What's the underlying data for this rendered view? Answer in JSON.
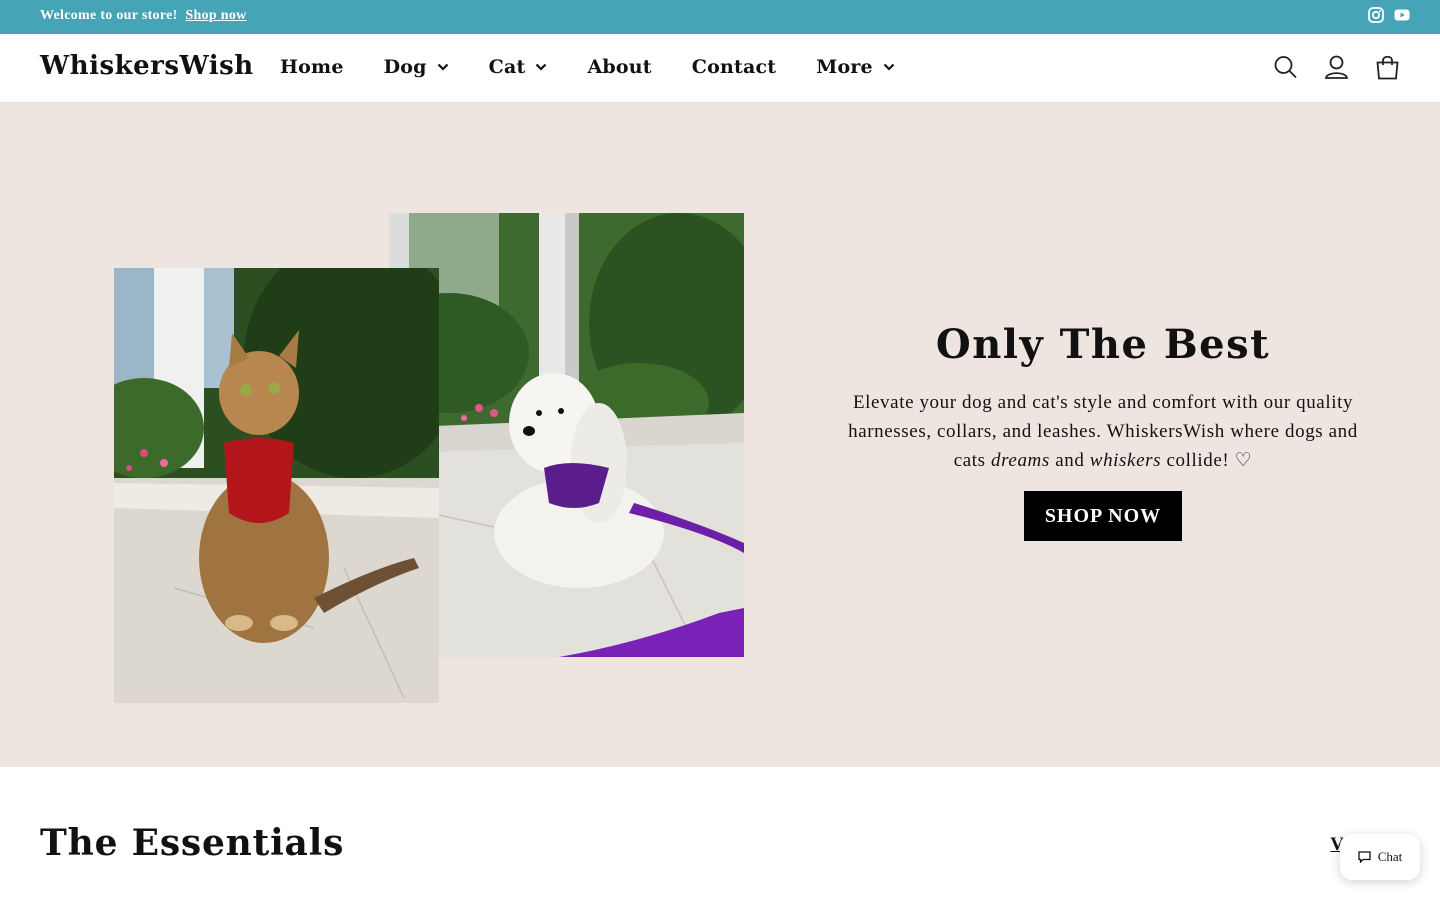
{
  "announcement": {
    "text": "Welcome to our store!",
    "link": "Shop now"
  },
  "social_icons": [
    "instagram-icon",
    "youtube-icon"
  ],
  "header": {
    "logo": "WhiskersWish",
    "nav": [
      {
        "label": "Home",
        "has_dropdown": false
      },
      {
        "label": "Dog",
        "has_dropdown": true
      },
      {
        "label": "Cat",
        "has_dropdown": true
      },
      {
        "label": "About",
        "has_dropdown": false
      },
      {
        "label": "Contact",
        "has_dropdown": false
      },
      {
        "label": "More",
        "has_dropdown": true
      }
    ],
    "icons": [
      "search-icon",
      "account-icon",
      "cart-icon"
    ]
  },
  "hero": {
    "title": "Only The Best",
    "body_before": "Elevate your dog and cat's style and comfort with our quality harnesses, collars, and leashes. WhiskersWish where dogs and cats ",
    "body_em1": "dreams",
    "body_and": " and ",
    "body_em2": "whiskers",
    "body_after": " collide! ♡",
    "button": "SHOP NOW"
  },
  "essentials": {
    "title": "The Essentials",
    "link": "V"
  },
  "chat": {
    "label": "Chat"
  },
  "colors": {
    "announcement_bg": "#46a4b7",
    "hero_bg": "#efe5e0",
    "button_bg": "#000000",
    "cat_harness": "#b3161a",
    "dog_harness": "#5b1d8c"
  }
}
